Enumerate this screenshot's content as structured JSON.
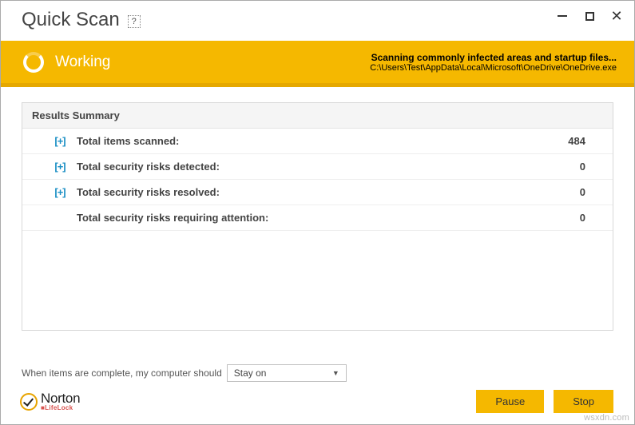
{
  "window": {
    "title": "Quick Scan",
    "help": "?"
  },
  "status": {
    "state": "Working",
    "headline": "Scanning commonly infected areas and startup files...",
    "path": "C:\\Users\\Test\\AppData\\Local\\Microsoft\\OneDrive\\OneDrive.exe"
  },
  "results": {
    "header": "Results Summary",
    "rows": [
      {
        "label": "Total items scanned:",
        "value": "484",
        "expandable": true
      },
      {
        "label": "Total security risks detected:",
        "value": "0",
        "expandable": true
      },
      {
        "label": "Total security risks resolved:",
        "value": "0",
        "expandable": true
      },
      {
        "label": "Total security risks requiring attention:",
        "value": "0",
        "expandable": false
      }
    ]
  },
  "postscan": {
    "label": "When items are complete, my computer should",
    "selected": "Stay on"
  },
  "branding": {
    "name": "Norton",
    "sub": "LifeLock"
  },
  "buttons": {
    "pause": "Pause",
    "stop": "Stop"
  },
  "watermark": "wsxdn.com",
  "expand_glyph": "[+]"
}
